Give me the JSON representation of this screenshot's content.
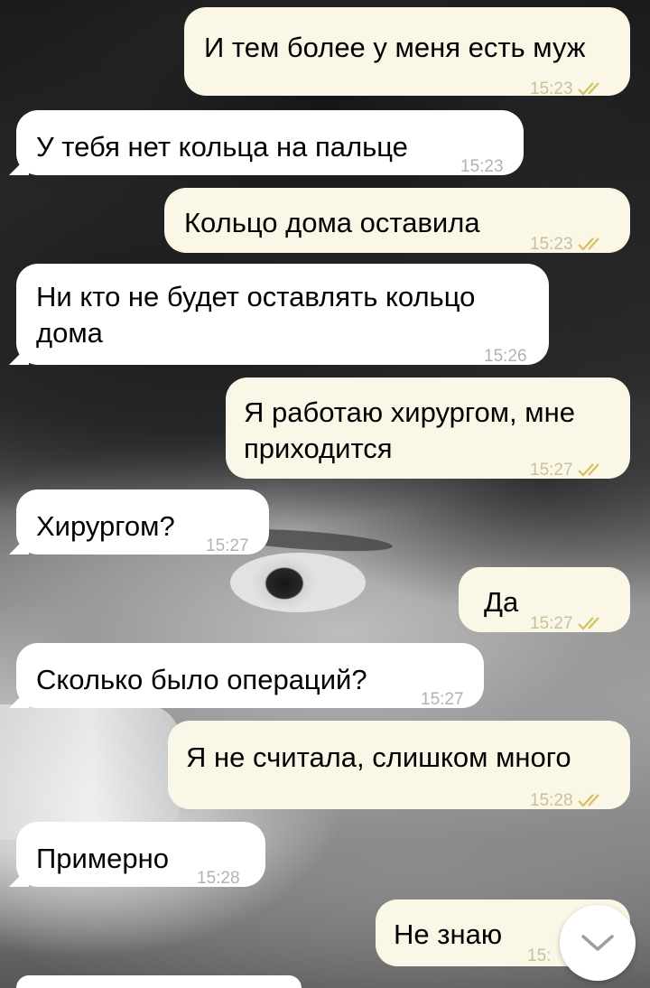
{
  "chat": {
    "messages": [
      {
        "direction": "outgoing",
        "text": "И тем более у меня есть муж",
        "time": "15:23",
        "status": "read"
      },
      {
        "direction": "incoming",
        "text": "У тебя нет кольца на пальце",
        "time": "15:23"
      },
      {
        "direction": "outgoing",
        "text": "Кольцо дома оставила",
        "time": "15:23",
        "status": "read"
      },
      {
        "direction": "incoming",
        "text_line1": "Ни кто не будет оставлять кольцо",
        "text_line2": "дома",
        "time": "15:26"
      },
      {
        "direction": "outgoing",
        "text_line1": "Я работаю хирургом, мне",
        "text_line2": "приходится",
        "time": "15:27",
        "status": "read"
      },
      {
        "direction": "incoming",
        "text": "Хирургом?",
        "time": "15:27"
      },
      {
        "direction": "outgoing",
        "text": "Да",
        "time": "15:27",
        "status": "read"
      },
      {
        "direction": "incoming",
        "text": "Сколько было операций?",
        "time": "15:27"
      },
      {
        "direction": "outgoing",
        "text": "Я не считала, слишком много",
        "time": "15:28",
        "status": "read"
      },
      {
        "direction": "incoming",
        "text": "Примерно",
        "time": "15:28"
      },
      {
        "direction": "outgoing",
        "text": "Не знаю",
        "time": "15:"
      }
    ],
    "scroll_down_icon": "chevron-down-icon"
  },
  "colors": {
    "incoming_bubble": "#ffffff",
    "outgoing_bubble": "#fbf7e7",
    "read_ticks": "#d4c063",
    "timestamp": "#b2b2b2"
  }
}
